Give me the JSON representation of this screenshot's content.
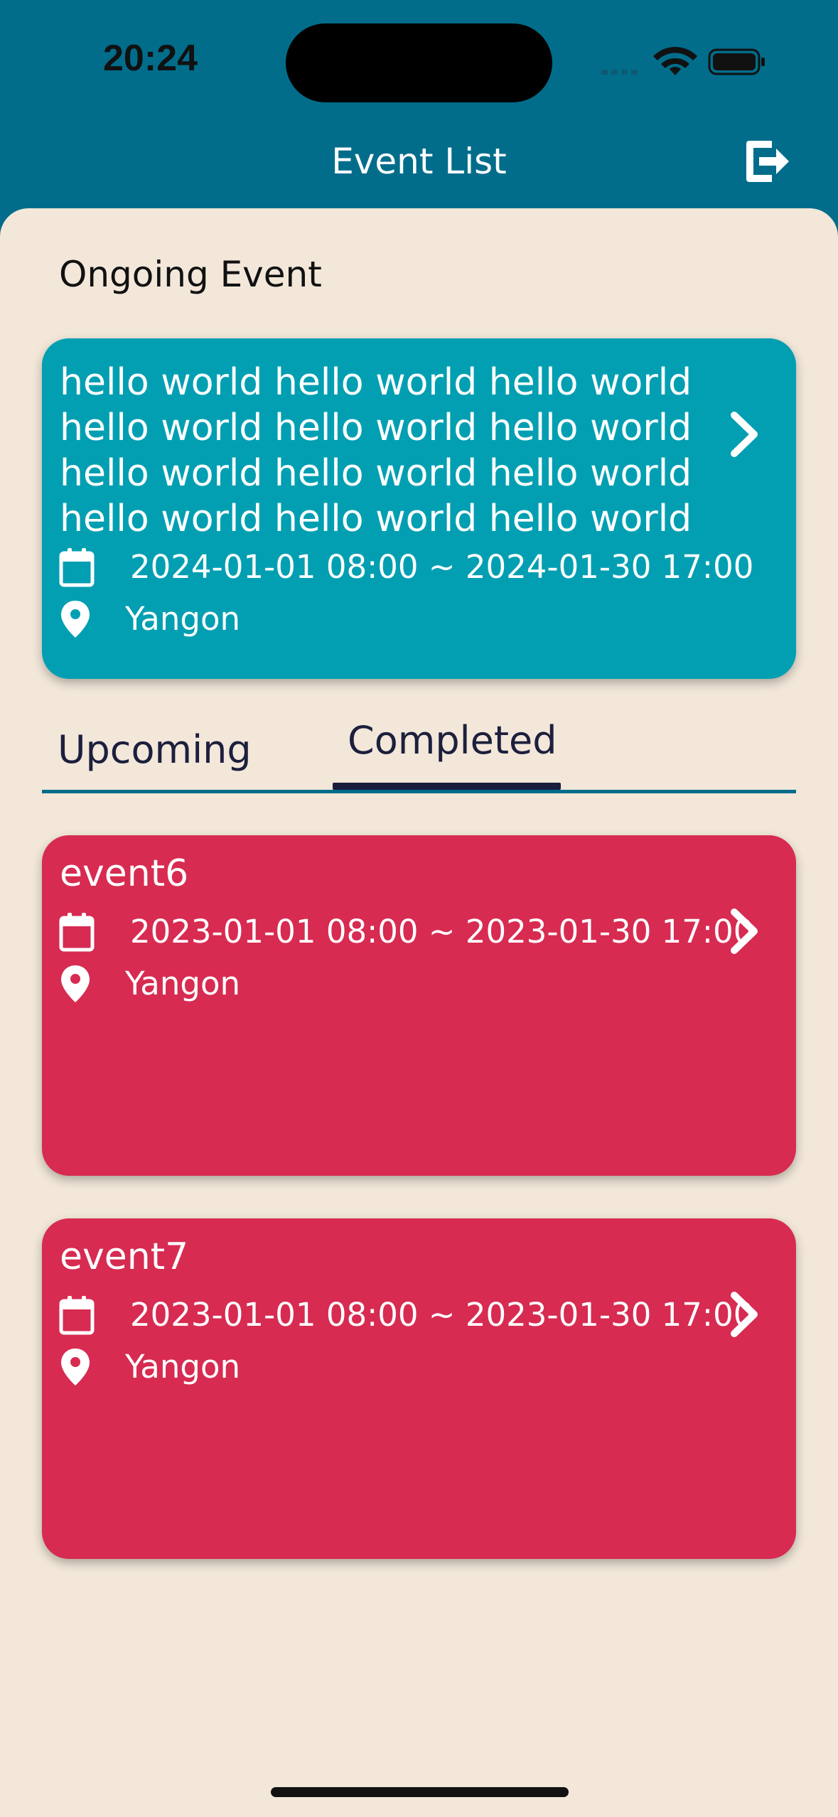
{
  "status": {
    "time": "20:24"
  },
  "header": {
    "title": "Event List"
  },
  "ongoing": {
    "section_title": "Ongoing Event",
    "card": {
      "title": "hello world hello world hello world hello world hello world hello world hello world hello world hello world hello world hello world hello world",
      "date_range": "2024-01-01 08:00 ~ 2024-01-30 17:00",
      "location": "Yangon"
    }
  },
  "tabs": {
    "upcoming": "Upcoming",
    "completed": "Completed",
    "selected": "Completed"
  },
  "events": [
    {
      "title": "event6",
      "date_range": "2023-01-01 08:00 ~ 2023-01-30 17:00",
      "location": "Yangon"
    },
    {
      "title": "event7",
      "date_range": "2023-01-01 08:00 ~ 2023-01-30 17:00",
      "location": "Yangon"
    }
  ],
  "colors": {
    "header_bg": "#016d8b",
    "sheet_bg": "#f2e7d9",
    "ongoing_card": "#029fb2",
    "completed_card": "#d72b51",
    "tab_indicator": "#1a1d3b"
  },
  "icons": {
    "logout": "logout-icon",
    "chevron": "chevron-right-icon",
    "calendar": "calendar-icon",
    "location": "location-pin-icon"
  }
}
